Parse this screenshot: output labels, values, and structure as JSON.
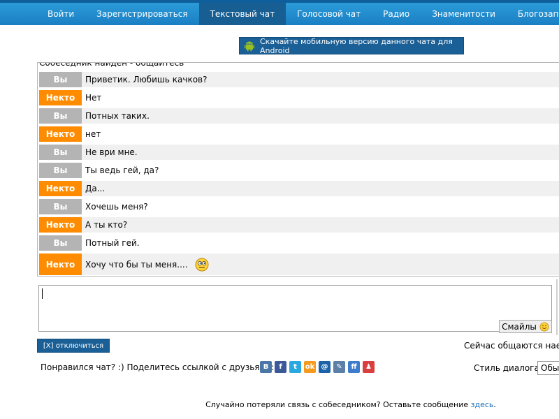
{
  "nav": {
    "items": [
      {
        "label": "Войти",
        "active": false
      },
      {
        "label": "Зарегистрироваться",
        "active": false
      },
      {
        "label": "Текстовый чат",
        "active": true
      },
      {
        "label": "Голосовой чат",
        "active": false
      },
      {
        "label": "Радио",
        "active": false
      },
      {
        "label": "Знаменитости",
        "active": false
      },
      {
        "label": "Блогозаписи",
        "active": false
      }
    ]
  },
  "android_button": {
    "label": "Скачайте мобильную версию данного чата для Android"
  },
  "chat": {
    "header": "Собеседник найден - общайтесь",
    "messages": [
      {
        "who": "Вы",
        "role": "you",
        "text": "Приветик. Любишь качков?"
      },
      {
        "who": "Некто",
        "role": "stranger",
        "text": "Нет"
      },
      {
        "who": "Вы",
        "role": "you",
        "text": "Потных таких."
      },
      {
        "who": "Некто",
        "role": "stranger",
        "text": "нет"
      },
      {
        "who": "Вы",
        "role": "you",
        "text": "Не ври мне."
      },
      {
        "who": "Вы",
        "role": "you",
        "text": "Ты ведь гей, да?"
      },
      {
        "who": "Некто",
        "role": "stranger",
        "text": "Да..."
      },
      {
        "who": "Вы",
        "role": "you",
        "text": "Хочешь меня?"
      },
      {
        "who": "Некто",
        "role": "stranger",
        "text": "А ты кто?"
      },
      {
        "who": "Вы",
        "role": "you",
        "text": "Потный гей."
      },
      {
        "who": "Некто",
        "role": "stranger",
        "text": "Хочу что бы ты меня....",
        "emoticon": "smiley-glasses-icon"
      }
    ]
  },
  "composer": {
    "value": "",
    "smiles_label": "Смайлы"
  },
  "disconnect_button": {
    "label": "[X] отключиться"
  },
  "online_text": "Сейчас общаются наед",
  "share": {
    "label": "Понравился чат? :) Поделитесь ссылкой с друзьями:",
    "icons": [
      {
        "name": "vkontakte-icon",
        "glyph": "B",
        "color": "#4a76a8"
      },
      {
        "name": "facebook-icon",
        "glyph": "f",
        "color": "#3b5998"
      },
      {
        "name": "twitter-icon",
        "glyph": "t",
        "color": "#2aa9e0"
      },
      {
        "name": "odnoklassniki-icon",
        "glyph": "ok",
        "color": "#f59a1e"
      },
      {
        "name": "mailru-icon",
        "glyph": "@",
        "color": "#1a63a8"
      },
      {
        "name": "livejournal-icon",
        "glyph": "✎",
        "color": "#5b7fa6"
      },
      {
        "name": "friendfeed-icon",
        "glyph": "ff",
        "color": "#3d7bcc"
      },
      {
        "name": "moikrug-icon",
        "glyph": "♟",
        "color": "#d93f3f"
      }
    ]
  },
  "dialog_style": {
    "label": "Стиль диалога:",
    "selected": "Обы"
  },
  "lost_connection": {
    "text": "Случайно потеряли связь с собеседником? Оставьте сообщение ",
    "link": "здесь",
    "tail": "."
  }
}
